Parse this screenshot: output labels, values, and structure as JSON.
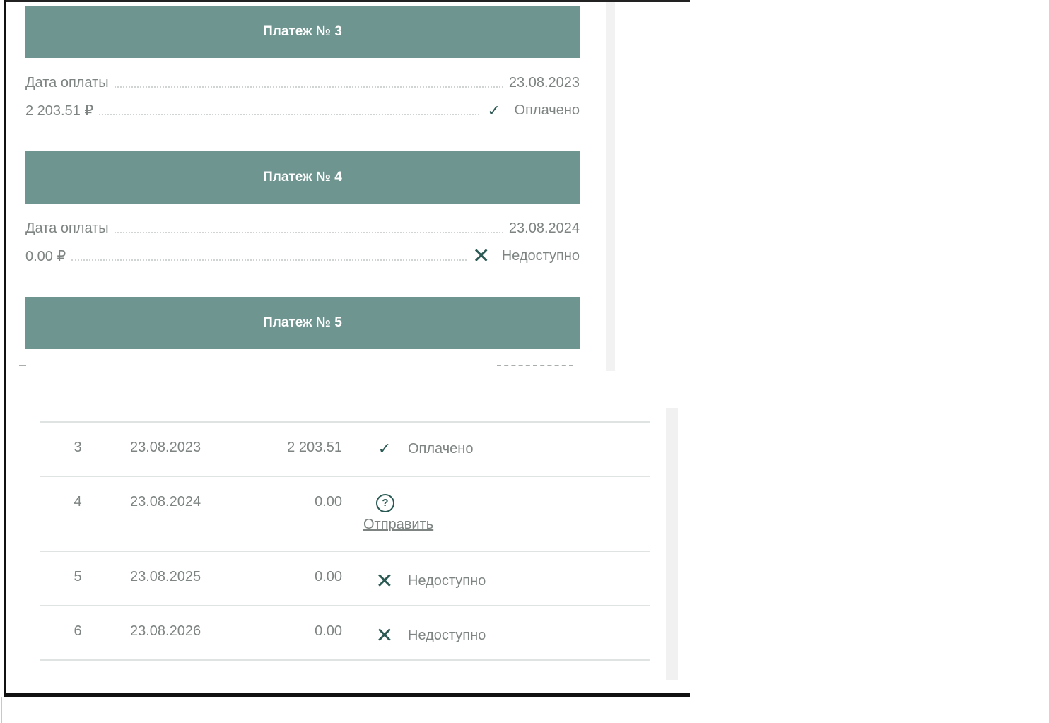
{
  "mobile_cards": [
    {
      "title": "Платеж № 3",
      "date_label": "Дата оплаты",
      "date": "23.08.2023",
      "amount": "2 203.51 ₽",
      "status": "Оплачено",
      "status_icon": "check-icon"
    },
    {
      "title": "Платеж № 4",
      "date_label": "Дата оплаты",
      "date": "23.08.2024",
      "amount": "0.00 ₽",
      "status": "Недоступно",
      "status_icon": "cross-icon"
    },
    {
      "title": "Платеж № 5"
    }
  ],
  "table": {
    "rows": [
      {
        "num": "3",
        "date": "23.08.2023",
        "amount": "2 203.51",
        "status": "Оплачено",
        "status_icon": "check-icon"
      },
      {
        "num": "4",
        "date": "23.08.2024",
        "amount": "0.00",
        "status_icon": "help-circle-icon",
        "action": "Отправить"
      },
      {
        "num": "5",
        "date": "23.08.2025",
        "amount": "0.00",
        "status": "Недоступно",
        "status_icon": "cross-icon"
      },
      {
        "num": "6",
        "date": "23.08.2026",
        "amount": "0.00",
        "status": "Недоступно",
        "status_icon": "cross-icon"
      }
    ]
  },
  "colors": {
    "header_bg": "#6f9590",
    "icon": "#2b5a55",
    "text": "#7d8482"
  }
}
